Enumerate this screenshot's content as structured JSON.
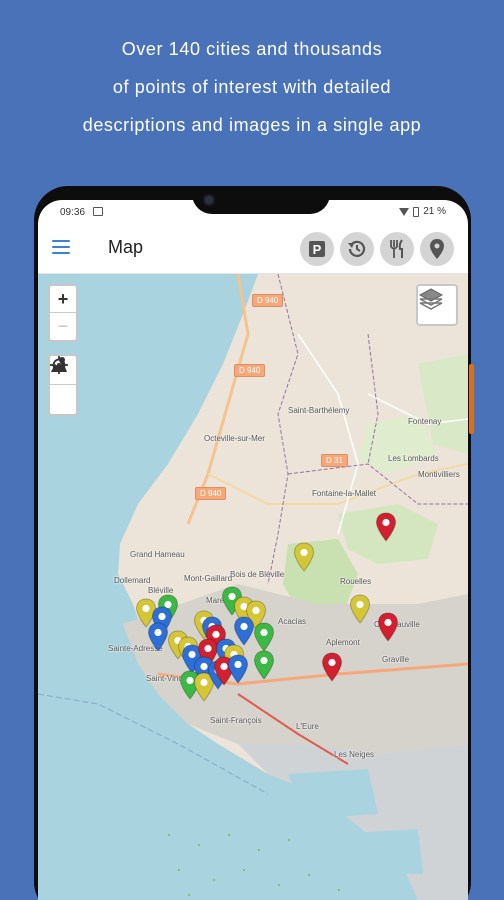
{
  "promo": {
    "line1": "Over 140 cities and thousands",
    "line2": "of points of interest with detailed",
    "line3": "descriptions and images in a single app"
  },
  "status": {
    "time": "09:36",
    "battery": "21 %"
  },
  "appbar": {
    "title": "Map",
    "actions": [
      "parking-icon",
      "history-icon",
      "restaurant-icon",
      "location-pin-icon"
    ]
  },
  "map_controls": {
    "zoom_in": "+",
    "zoom_out": "−"
  },
  "road_labels": [
    "D 940",
    "D 940",
    "D 940",
    "D 31"
  ],
  "places": [
    "Saint-Barthélemy",
    "Fontenay",
    "Octeville-sur-Mer",
    "Les Lombards",
    "Montivilliers",
    "Fontaine-la-Mallet",
    "Grand Hameau",
    "Bois de Bléville",
    "Dollemard",
    "Mont-Gaillard",
    "Bléville",
    "Rouelles",
    "Mare Rouge",
    "Caucriauville",
    "Acacias",
    "Aplemont",
    "Sainte-Adresse",
    "Saint-Vincent",
    "Graville",
    "L'Eure",
    "Les Neiges",
    "Saint-François"
  ],
  "colors": {
    "background": "#4a72b8",
    "accent": "#3a82d8",
    "land": "#ece4d8",
    "sea": "#a9d3df",
    "marker_red": "#d32030",
    "marker_blue": "#2d6fd6",
    "marker_green": "#3cb844",
    "marker_yellow": "#d4c637"
  }
}
